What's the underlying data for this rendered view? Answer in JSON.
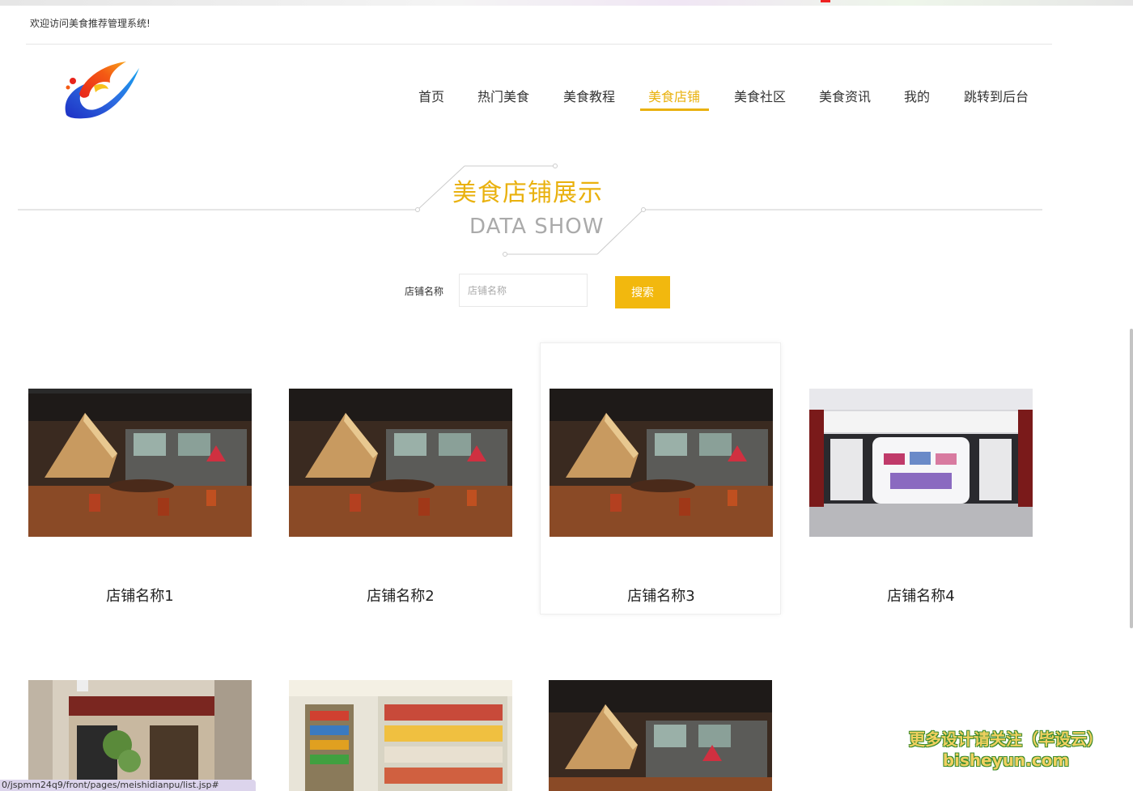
{
  "header": {
    "welcome": "欢迎访问美食推荐管理系统!",
    "logo_icon": "brand-logo-icon"
  },
  "nav": {
    "items": [
      {
        "label": "首页",
        "active": false
      },
      {
        "label": "热门美食",
        "active": false
      },
      {
        "label": "美食教程",
        "active": false
      },
      {
        "label": "美食店铺",
        "active": true
      },
      {
        "label": "美食社区",
        "active": false
      },
      {
        "label": "美食资讯",
        "active": false
      },
      {
        "label": "我的",
        "active": false
      },
      {
        "label": "跳转到后台",
        "active": false
      }
    ],
    "accent_color": "#e9b10e"
  },
  "section": {
    "title_cn": "美食店铺展示",
    "title_en": "DATA SHOW"
  },
  "search": {
    "label": "店铺名称",
    "placeholder": "店铺名称",
    "button_label": "搜索"
  },
  "shops": [
    {
      "name": "店铺名称1",
      "image": "restaurant-interior"
    },
    {
      "name": "店铺名称2",
      "image": "restaurant-interior"
    },
    {
      "name": "店铺名称3",
      "image": "restaurant-interior"
    },
    {
      "name": "店铺名称4",
      "image": "boutique-storefront"
    },
    {
      "name": "",
      "image": "street-storefront"
    },
    {
      "name": "",
      "image": "supermarket-shelves"
    },
    {
      "name": "",
      "image": "restaurant-interior"
    }
  ],
  "status_bar": {
    "url": "0/jspmm24q9/front/pages/meishidianpu/list.jsp#"
  },
  "watermark": {
    "line1": "更多设计请关注（毕设云）",
    "line2": "bisheyun.com"
  }
}
